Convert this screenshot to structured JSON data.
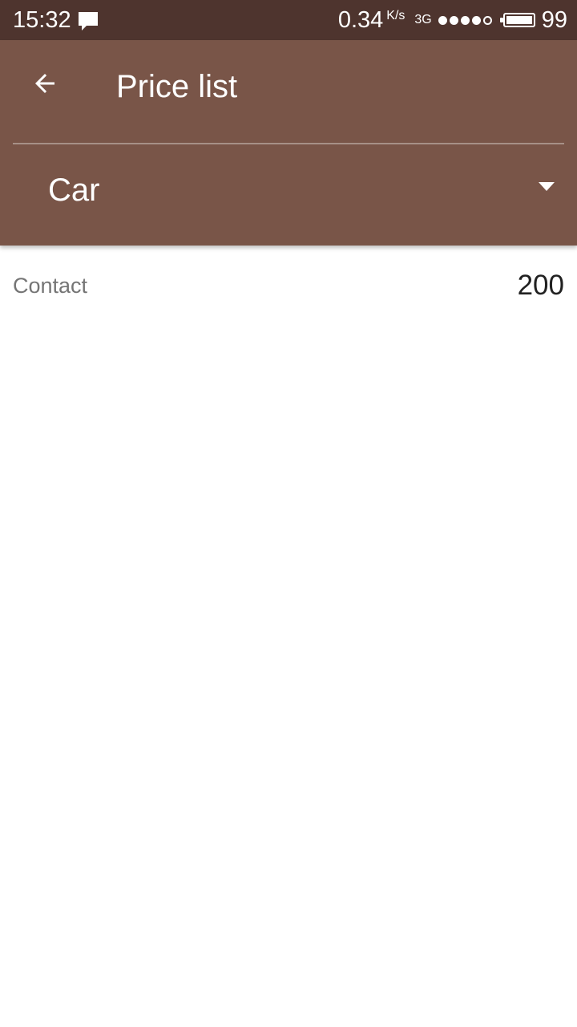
{
  "status_bar": {
    "time": "15:32",
    "net_speed": "0.34",
    "net_unit": "K/s",
    "net_type": "3G",
    "signal_dots_filled": 4,
    "signal_dots_total": 5,
    "battery_level": "99"
  },
  "app_bar": {
    "title": "Price list",
    "back_icon": "arrow-back-icon"
  },
  "category_spinner": {
    "selected": "Car",
    "arrow_icon": "dropdown-arrow-icon"
  },
  "price_items": [
    {
      "label": "Contact",
      "price": "200"
    }
  ],
  "colors": {
    "status_bar": "#4e342e",
    "app_bar": "#795548",
    "label_text": "#757575",
    "price_text": "#212121",
    "background": "#ffffff"
  }
}
